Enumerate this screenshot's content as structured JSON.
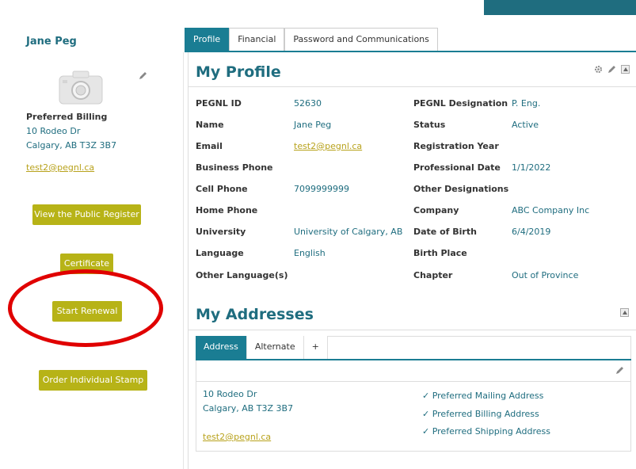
{
  "sidebar": {
    "name": "Jane Peg",
    "billing_title": "Preferred Billing",
    "address_line1": "10 Rodeo Dr",
    "address_line2": "Calgary, AB T3Z 3B7",
    "email": "test2@pegnl.ca",
    "buttons": {
      "public_register": "View the Public Register",
      "certificate": "Certificate",
      "start_renewal": "Start Renewal",
      "order_stamp": "Order Individual Stamp"
    }
  },
  "tabs": [
    "Profile",
    "Financial",
    "Password and Communications"
  ],
  "profile": {
    "title": "My Profile",
    "left_fields": [
      {
        "label": "PEGNL ID",
        "value": "52630"
      },
      {
        "label": "Name",
        "value": "Jane Peg"
      },
      {
        "label": "Email",
        "value": "test2@pegnl.ca"
      },
      {
        "label": "Business Phone",
        "value": ""
      },
      {
        "label": "Cell Phone",
        "value": "7099999999"
      },
      {
        "label": "Home Phone",
        "value": ""
      },
      {
        "label": "University",
        "value": "University of Calgary, AB"
      },
      {
        "label": "Language",
        "value": "English"
      },
      {
        "label": "Other Language(s)",
        "value": ""
      }
    ],
    "right_fields": [
      {
        "label": "PEGNL Designation",
        "value": "P. Eng."
      },
      {
        "label": "Status",
        "value": "Active"
      },
      {
        "label": "Registration Year",
        "value": ""
      },
      {
        "label": "Professional Date",
        "value": "1/1/2022"
      },
      {
        "label": "Other Designations",
        "value": ""
      },
      {
        "label": "Company",
        "value": "ABC Company Inc"
      },
      {
        "label": "Date of Birth",
        "value": "6/4/2019"
      },
      {
        "label": "Birth Place",
        "value": ""
      },
      {
        "label": "Chapter",
        "value": "Out of Province"
      }
    ]
  },
  "addresses": {
    "title": "My Addresses",
    "tabs": [
      "Address",
      "Alternate",
      "+"
    ],
    "line1": "10 Rodeo Dr",
    "line2": "Calgary, AB T3Z 3B7",
    "email": "test2@pegnl.ca",
    "preferences": [
      "✓ Preferred Mailing Address",
      "✓ Preferred Billing Address",
      "✓ Preferred Shipping Address"
    ]
  },
  "colors": {
    "accent": "#1a7d93",
    "button": "#b7b317",
    "highlight_circle": "#e00000"
  }
}
